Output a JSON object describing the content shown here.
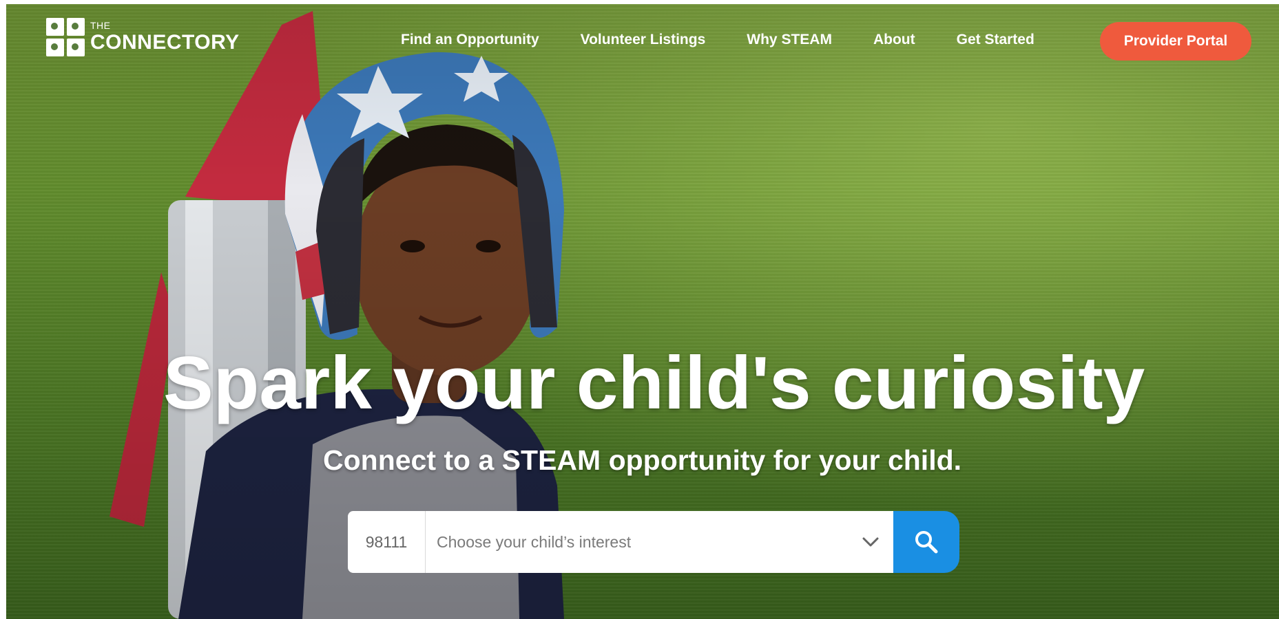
{
  "header": {
    "logo": {
      "top_text": "THE",
      "name": "CONNECTORY"
    },
    "nav": [
      {
        "label": "Find an Opportunity"
      },
      {
        "label": "Volunteer Listings"
      },
      {
        "label": "Why STEAM"
      },
      {
        "label": "About"
      },
      {
        "label": "Get Started"
      }
    ],
    "provider_button": "Provider Portal"
  },
  "hero": {
    "headline": "Spark your child's curiosity",
    "subheadline": "Connect to a STEAM opportunity for your child."
  },
  "search": {
    "zip_value": "98111",
    "interest_placeholder": "Choose your child’s interest"
  },
  "colors": {
    "accent_orange": "#ef5a3d",
    "search_blue": "#1a8fe3",
    "grass": "#5f8a2c"
  },
  "icons": {
    "logo": "connectory-logo-icon",
    "dropdown": "chevron-down-icon",
    "search": "search-icon"
  }
}
